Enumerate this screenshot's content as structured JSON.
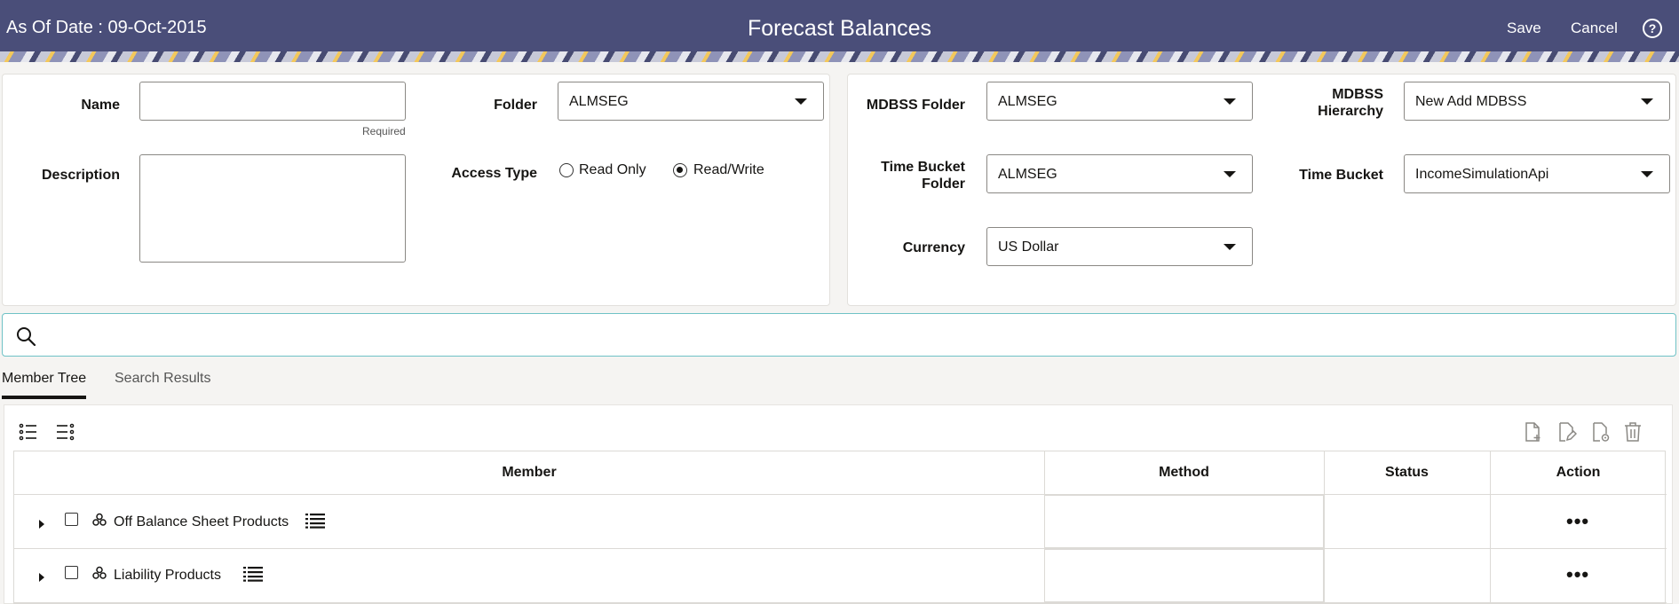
{
  "header": {
    "as_of": "As Of Date : 09-Oct-2015",
    "title": "Forecast Balances",
    "save_label": "Save",
    "cancel_label": "Cancel",
    "help_icon": "question-circle-icon",
    "bg_color": "#4a4e79"
  },
  "details": {
    "name_label": "Name",
    "name_value": "",
    "required_hint": "Required",
    "description_label": "Description",
    "description_value": "",
    "folder_label": "Folder",
    "folder_value": "ALMSEG",
    "access_type_label": "Access Type",
    "access_options": [
      {
        "label": "Read Only",
        "checked": false
      },
      {
        "label": "Read/Write",
        "checked": true
      }
    ]
  },
  "mdbss": {
    "mdbss_folder_label": "MDBSS Folder",
    "mdbss_folder_value": "ALMSEG",
    "mdbss_hierarchy_label_1": "MDBSS",
    "mdbss_hierarchy_label_2": "Hierarchy",
    "mdbss_hierarchy_value": "New Add MDBSS",
    "time_bucket_folder_label_1": "Time Bucket",
    "time_bucket_folder_label_2": "Folder",
    "time_bucket_folder_value": "ALMSEG",
    "time_bucket_label": "Time Bucket",
    "time_bucket_value": "IncomeSimulationApi",
    "currency_label": "Currency",
    "currency_value": "US Dollar"
  },
  "search": {
    "placeholder": "",
    "icon": "search-icon",
    "border_color": "#6fc2c6"
  },
  "tabs": [
    {
      "label": "Member Tree",
      "active": true
    },
    {
      "label": "Search Results",
      "active": false
    }
  ],
  "grid": {
    "columns": [
      "Member",
      "Method",
      "Status",
      "Action"
    ],
    "rows": [
      {
        "member": "Off Balance Sheet Products",
        "method": "",
        "status": "",
        "action": "•••"
      },
      {
        "member": "Liability Products",
        "method": "",
        "status": "",
        "action": "•••"
      }
    ]
  }
}
